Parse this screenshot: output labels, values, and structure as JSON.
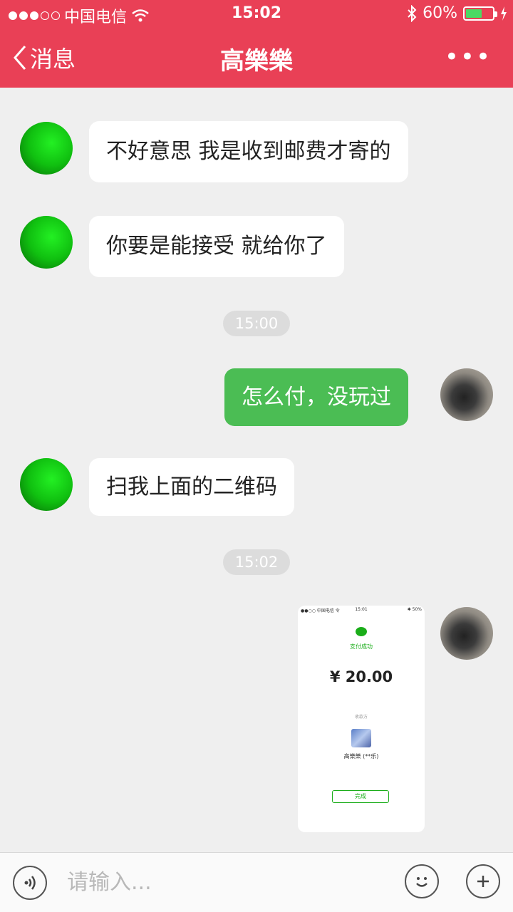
{
  "status_bar": {
    "carrier": "中国电信",
    "time": "15:02",
    "battery_percent": "60%",
    "battery_level": 0.6
  },
  "nav": {
    "back_label": "消息",
    "title": "高樂樂",
    "more_label": "•••"
  },
  "messages": [
    {
      "side": "in",
      "text": "不好意思 我是收到邮费才寄的"
    },
    {
      "side": "in",
      "text": "你要是能接受 就给你了"
    },
    {
      "type": "time",
      "text": "15:00"
    },
    {
      "side": "out",
      "text": "怎么付，没玩过"
    },
    {
      "side": "in",
      "text": "扫我上面的二维码"
    },
    {
      "type": "time",
      "text": "15:02"
    }
  ],
  "image_message": {
    "status_left": "●●○○ 中国电信 令",
    "status_time": "15:01",
    "status_right": "✱ 50%",
    "success_text": "支付成功",
    "amount": "¥ 20.00",
    "payee_label": "收款方",
    "payee_name": "高樂樂 (**乐)",
    "done_label": "完成"
  },
  "input_bar": {
    "placeholder": "请输入..."
  },
  "colors": {
    "header": "#e94056",
    "out_bubble": "#4bbd54",
    "in_bubble": "#ffffff",
    "background": "#efefef"
  }
}
